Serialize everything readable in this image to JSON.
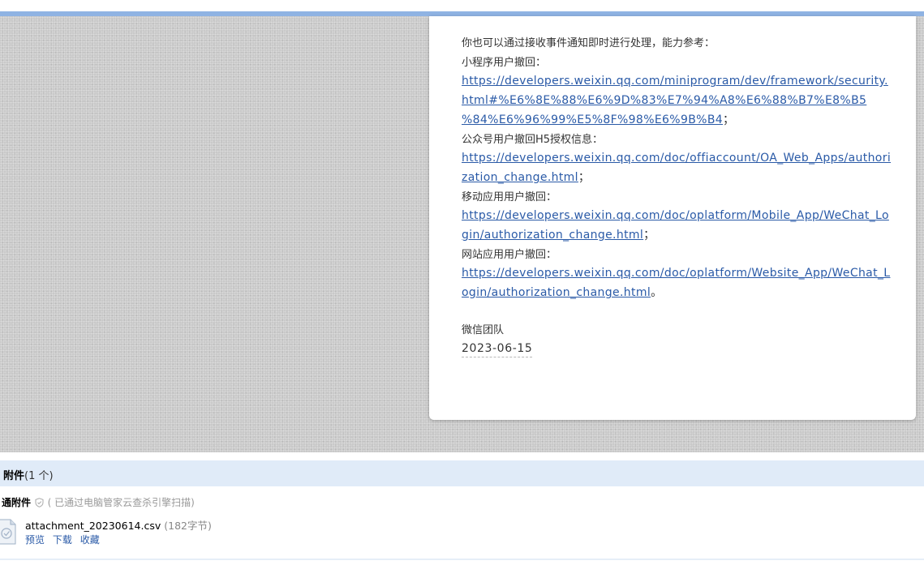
{
  "mail": {
    "intro": "你也可以通过接收事件通知即时进行处理，能力参考：",
    "sections": [
      {
        "label": "小程序用户撤回：",
        "link_lines": [
          "https://developers.weixin.qq.com/miniprogram/dev/framework/security.",
          "html#%E6%8E%88%E6%9D%83%E7%94%A8%E6%88%B7%E8%B5",
          "%84%E6%96%99%E5%8F%98%E6%9B%B4"
        ],
        "punct": "；"
      },
      {
        "label": "公众号用户撤回H5授权信息：",
        "link_lines": [
          "https://developers.weixin.qq.com/doc/offiaccount/OA_Web_Apps/authori",
          "zation_change.html"
        ],
        "punct": "；"
      },
      {
        "label": "移动应用用户撤回：",
        "link_lines": [
          "https://developers.weixin.qq.com/doc/oplatform/Mobile_App/WeChat_Lo",
          "gin/authorization_change.html"
        ],
        "punct": "；"
      },
      {
        "label": "网站应用用户撤回：",
        "link_lines": [
          "https://developers.weixin.qq.com/doc/oplatform/Website_App/WeChat_L",
          "ogin/authorization_change.html"
        ],
        "punct": "。"
      }
    ],
    "signature": "微信团队",
    "date": "2023-06-15"
  },
  "attachments": {
    "header_label": "附件",
    "header_count": "(1 个)",
    "normal_label": "通附件",
    "scan_note": "( 已通过电脑管家云查杀引擎扫描)",
    "file": {
      "name": "attachment_20230614.csv",
      "size": "(182字节)",
      "actions": [
        "预览",
        "下载",
        "收藏"
      ]
    }
  },
  "colors": {
    "link": "#2a5aa7",
    "top_stripe": "#8fb3e3",
    "attach_header_bg": "#e0ebf8",
    "backdrop": "#c9c9c9"
  }
}
